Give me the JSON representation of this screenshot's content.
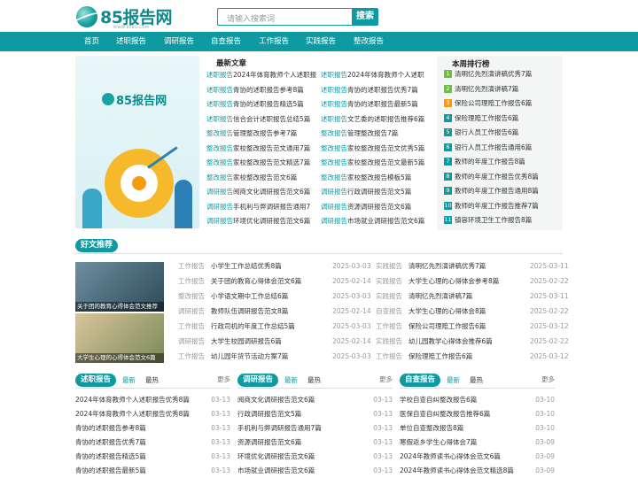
{
  "header": {
    "logo_text": "85报告网",
    "logo_sub": "WWW.85BG.COM",
    "search_placeholder": "请输入搜索词",
    "search_button": "搜索"
  },
  "nav": [
    "首页",
    "述职报告",
    "调研报告",
    "自查报告",
    "工作报告",
    "实践报告",
    "整改报告"
  ],
  "banner": {
    "logo_text": "85报告网"
  },
  "latest": {
    "title": "最新文章",
    "left": [
      {
        "cat": "述职报告",
        "title": "2024年体育教师个人述职报"
      },
      {
        "cat": "述职报告",
        "title": "青协的述职报告参考8篇"
      },
      {
        "cat": "述职报告",
        "title": "青协的述职报告精选5篇"
      },
      {
        "cat": "述职报告",
        "title": "信合会计述职报告总结5篇"
      },
      {
        "cat": "整改报告",
        "title": "管理整改报告参考7篇"
      },
      {
        "cat": "整改报告",
        "title": "家校整改报告范文通用7篇"
      },
      {
        "cat": "整改报告",
        "title": "家校整改报告范文精选7篇"
      },
      {
        "cat": "整改报告",
        "title": "家校整改报告范文6篇"
      },
      {
        "cat": "调研报告",
        "title": "阅商文化调研报告范文6篇"
      },
      {
        "cat": "调研报告",
        "title": "手机利与弊调研报告通用7"
      },
      {
        "cat": "调研报告",
        "title": "环境优化调研报告范文6篇"
      }
    ],
    "right": [
      {
        "cat": "述职报告",
        "title": "2024年体育教师个人述职"
      },
      {
        "cat": "述职报告",
        "title": "青协的述职报告优秀7篇"
      },
      {
        "cat": "述职报告",
        "title": "青协的述职报告最新5篇"
      },
      {
        "cat": "述职报告",
        "title": "文艺委的述职报告推荐6篇"
      },
      {
        "cat": "整改报告",
        "title": "管理整改报告7篇"
      },
      {
        "cat": "整改报告",
        "title": "家校整改报告范文优秀5篇"
      },
      {
        "cat": "整改报告",
        "title": "家校整改报告范文最新5篇"
      },
      {
        "cat": "整改报告",
        "title": "家校整改报告模板5篇"
      },
      {
        "cat": "调研报告",
        "title": "行政调研报告范文5篇"
      },
      {
        "cat": "调研报告",
        "title": "资源调研报告范文6篇"
      },
      {
        "cat": "调研报告",
        "title": "市场就业调研报告范文6篇"
      }
    ]
  },
  "rank": {
    "title": "本周排行榜",
    "items": [
      {
        "num": "1",
        "title": "清明忆先烈演讲稿优秀7篇",
        "color": "#6cbf3f"
      },
      {
        "num": "2",
        "title": "清明忆先烈演讲稿7篇",
        "color": "#6cbf3f"
      },
      {
        "num": "3",
        "title": "保险公司理赔工作报告6篇",
        "color": "#f39c12"
      },
      {
        "num": "4",
        "title": "保险理赔工作报告6篇",
        "color": "#0e9aa0"
      },
      {
        "num": "5",
        "title": "银行人员工作报告6篇",
        "color": "#0e9aa0"
      },
      {
        "num": "6",
        "title": "银行人员工作报告通用6篇",
        "color": "#0e9aa0"
      },
      {
        "num": "7",
        "title": "教师的年度工作报告8篇",
        "color": "#0e9aa0"
      },
      {
        "num": "8",
        "title": "教师的年度工作报告优秀8篇",
        "color": "#0e9aa0"
      },
      {
        "num": "9",
        "title": "教师的年度工作报告通用8篇",
        "color": "#0e9aa0"
      },
      {
        "num": "10",
        "title": "教师的年度工作报告推荐7篇",
        "color": "#0e9aa0"
      },
      {
        "num": "11",
        "title": "镇容环境卫生工作报告8篇",
        "color": "#0e9aa0"
      }
    ]
  },
  "picks": {
    "title": "好文推荐",
    "images": [
      "关于团的教育心得体会范文推荐",
      "大学生心理的心得体会范文6篇"
    ],
    "left": [
      {
        "cat": "工作报告",
        "title": "小学生工作总结优秀8篇",
        "date": "2025-03-03"
      },
      {
        "cat": "工作报告",
        "title": "关于团的教育心得体会范文6篇",
        "date": "2025-02-14"
      },
      {
        "cat": "整改报告",
        "title": "小学语文期中工作总结6篇",
        "date": "2025-03-03"
      },
      {
        "cat": "调研报告",
        "title": "教师队伍调研报告范文8篇",
        "date": "2025-02-14"
      },
      {
        "cat": "工作报告",
        "title": "行政司机的年度工作总结5篇",
        "date": "2025-03-03"
      },
      {
        "cat": "调研报告",
        "title": "大学生校园调研报告6篇",
        "date": "2025-02-14"
      },
      {
        "cat": "工作报告",
        "title": "幼儿园年货节活动方案7篇",
        "date": "2025-03-03"
      }
    ],
    "right": [
      {
        "cat": "实践报告",
        "title": "清明忆先烈演讲稿优秀7篇",
        "date": "2025-03-11"
      },
      {
        "cat": "实践报告",
        "title": "大学生心理的心得体会参考8篇",
        "date": "2025-02-22"
      },
      {
        "cat": "实践报告",
        "title": "清明忆先烈演讲稿7篇",
        "date": "2025-03-11"
      },
      {
        "cat": "自查报告",
        "title": "大学生心理的心得体会8篇",
        "date": "2025-02-22"
      },
      {
        "cat": "工作报告",
        "title": "保险公司理赔工作报告6篇",
        "date": "2025-03-12"
      },
      {
        "cat": "实践报告",
        "title": "幼儿园教学心得体会推荐6篇",
        "date": "2025-02-22"
      },
      {
        "cat": "工作报告",
        "title": "保险理赔工作报告6篇",
        "date": "2025-03-12"
      }
    ]
  },
  "panels": [
    {
      "title": "述职报告",
      "tab_new": "最新",
      "tab_hot": "最热",
      "more": "更多",
      "rows": [
        {
          "title": "2024年体育教师个人述职报告优秀8篇",
          "date": "03-13"
        },
        {
          "title": "2024年体育教师个人述职报告优秀8篇",
          "date": "03-13"
        },
        {
          "title": "青协的述职报告参考8篇",
          "date": "03-13"
        },
        {
          "title": "青协的述职报告优秀7篇",
          "date": "03-13"
        },
        {
          "title": "青协的述职报告精选5篇",
          "date": "03-13"
        },
        {
          "title": "青协的述职报告最新5篇",
          "date": "03-13"
        }
      ]
    },
    {
      "title": "调研报告",
      "tab_new": "最新",
      "tab_hot": "最热",
      "more": "更多",
      "rows": [
        {
          "title": "阅商文化调研报告范文6篇",
          "date": "03-13"
        },
        {
          "title": "行政调研报告范文5篇",
          "date": "03-13"
        },
        {
          "title": "手机利与弊调研报告通用7篇",
          "date": "03-13"
        },
        {
          "title": "资源调研报告范文6篇",
          "date": "03-13"
        },
        {
          "title": "环境优化调研报告范文6篇",
          "date": "03-13"
        },
        {
          "title": "市场就业调研报告范文6篇",
          "date": "03-13"
        }
      ]
    },
    {
      "title": "自查报告",
      "tab_new": "最新",
      "tab_hot": "最热",
      "more": "更多",
      "rows": [
        {
          "title": "学校自查自纠整改报告6篇",
          "date": "03-10"
        },
        {
          "title": "医保自查自纠整改报告推荐6篇",
          "date": "03-10"
        },
        {
          "title": "单位自查整改报告8篇",
          "date": "03-10"
        },
        {
          "title": "寒假返乡学生心得体会7篇",
          "date": "03-09"
        },
        {
          "title": "2024年教师读书心得体会范文6篇",
          "date": "03-09"
        },
        {
          "title": "2024年教师读书心得体会范文精选8篇",
          "date": "03-09"
        }
      ]
    }
  ]
}
